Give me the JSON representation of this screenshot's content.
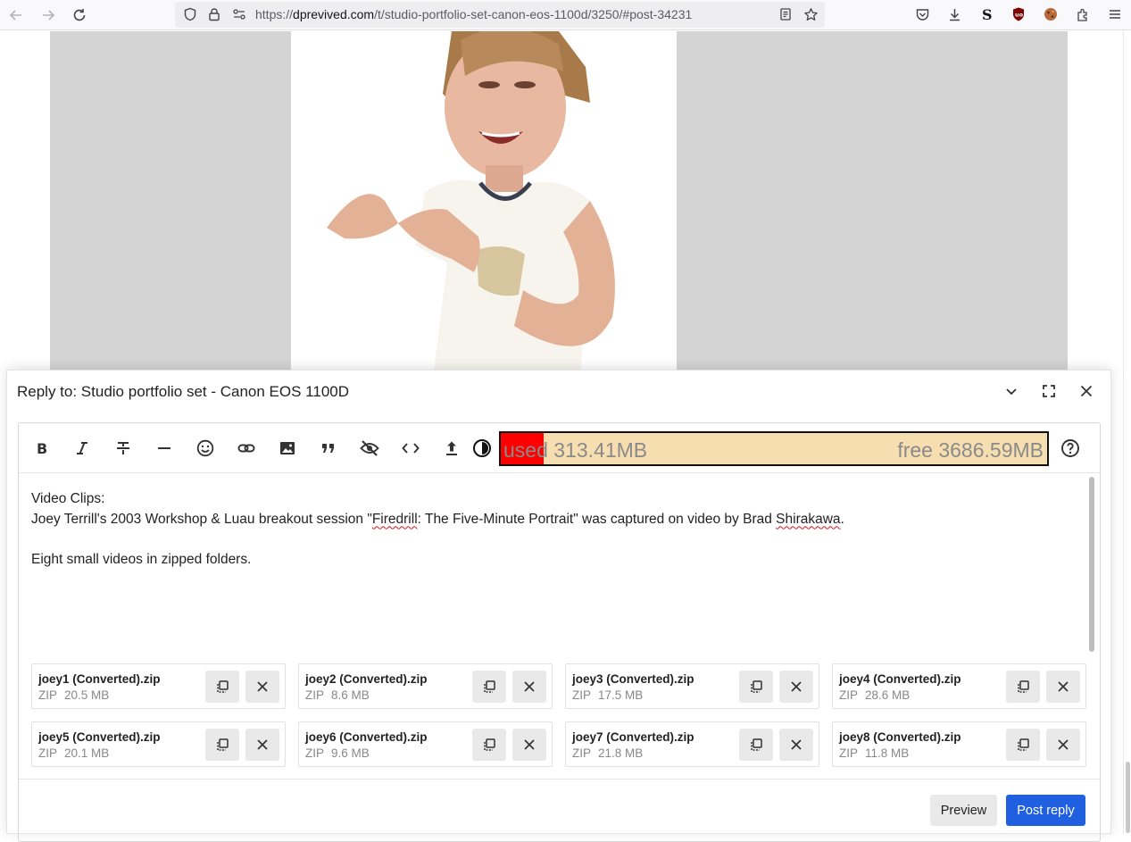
{
  "browser": {
    "url_prefix": "https://",
    "url_host": "dprevived.com",
    "url_path": "/t/studio-portfolio-set-canon-eos-1100d/3250/#post-34231"
  },
  "composer": {
    "title": "Reply to: Studio portfolio set - Canon EOS 1100D",
    "quota": {
      "used_label": "used 313.41MB",
      "free_label": "free 3686.59MB",
      "used_fraction": 0.078
    },
    "body": {
      "line1": "Video Clips:",
      "line2_a": "Joey Terrill's 2003 Workshop & Luau breakout session \"",
      "line2_b": "Firedrill",
      "line2_c": ": The Five-Minute Portrait\" was captured on video by Brad ",
      "line2_d": "Shirakawa",
      "line2_e": ".",
      "line4": "Eight small videos in zipped folders."
    },
    "attachments": [
      {
        "name": "joey1 (Converted).zip",
        "type": "ZIP",
        "size": "20.5 MB"
      },
      {
        "name": "joey2 (Converted).zip",
        "type": "ZIP",
        "size": "8.6 MB"
      },
      {
        "name": "joey3 (Converted).zip",
        "type": "ZIP",
        "size": "17.5 MB"
      },
      {
        "name": "joey4 (Converted).zip",
        "type": "ZIP",
        "size": "28.6 MB"
      },
      {
        "name": "joey5 (Converted).zip",
        "type": "ZIP",
        "size": "20.1 MB"
      },
      {
        "name": "joey6 (Converted).zip",
        "type": "ZIP",
        "size": "9.6 MB"
      },
      {
        "name": "joey7 (Converted).zip",
        "type": "ZIP",
        "size": "21.8 MB"
      },
      {
        "name": "joey8 (Converted).zip",
        "type": "ZIP",
        "size": "11.8 MB"
      }
    ],
    "buttons": {
      "preview": "Preview",
      "post": "Post reply"
    },
    "toolbar_icons": [
      "bold-icon",
      "italic-icon",
      "strikethrough-icon",
      "horizontal-rule-icon",
      "emoji-icon",
      "link-icon",
      "image-icon",
      "quote-icon",
      "hide-details-icon",
      "code-icon",
      "upload-icon",
      "theme-toggle-icon",
      "help-icon"
    ]
  },
  "colors": {
    "accent": "#1f5fe0",
    "quota_bg": "#f6deb0",
    "quota_used": "#ff0000"
  }
}
